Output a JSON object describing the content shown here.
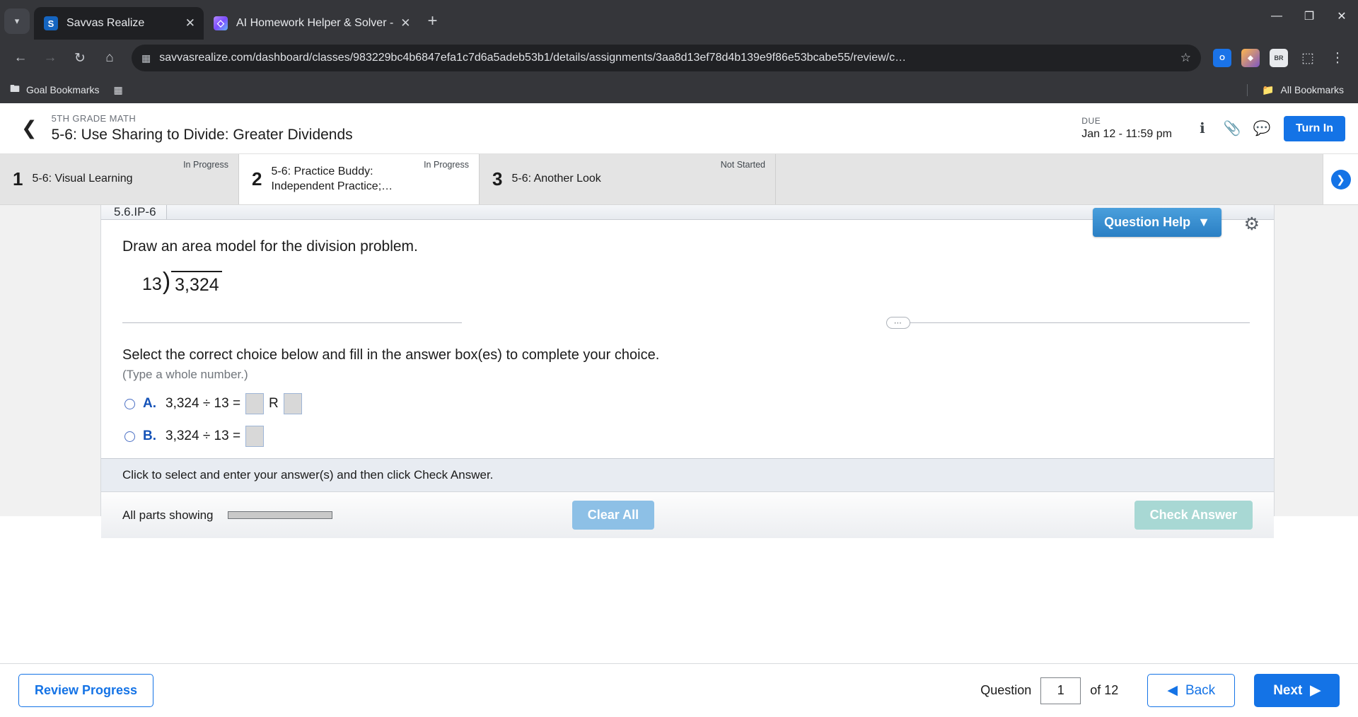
{
  "browser": {
    "tabs": [
      {
        "title": "Savvas Realize",
        "favicon": "savvas-icon",
        "active": true,
        "close_label": "✕"
      },
      {
        "title": "AI Homework Helper & Solver -",
        "favicon": "ai-helper-icon",
        "active": false,
        "close_label": "✕"
      }
    ],
    "new_tab_label": "+",
    "tab_list_icon": "chevron-down-icon",
    "window_controls": {
      "minimize": "—",
      "maximize": "❐",
      "close": "✕"
    },
    "nav": {
      "back": "←",
      "forward": "→",
      "reload": "↻",
      "home": "⌂"
    },
    "omnibox": {
      "site_icon": "page-info-icon",
      "url": "savvasrealize.com/dashboard/classes/983229bc4b6847efa1c7d6a5adeb53b1/details/assignments/3aa8d13ef78d4b139e9f86e53bcabe55/review/c…",
      "star_icon": "☆"
    },
    "extensions": [
      {
        "name": "office-extension",
        "label": "O"
      },
      {
        "name": "grammar-extension",
        "label": "◆"
      },
      {
        "name": "br-extension",
        "label": "BR"
      },
      {
        "name": "extensions-puzzle-icon",
        "label": "⬚"
      }
    ],
    "menu_icon": "⋮",
    "bookmarks": {
      "items": [
        {
          "label": "Goal Bookmarks",
          "icon": "folder-gear-icon"
        },
        {
          "label": "",
          "icon": "apps-grid-icon"
        }
      ],
      "all_bookmarks": {
        "label": "All Bookmarks",
        "icon": "folder-icon"
      }
    }
  },
  "app_header": {
    "back_icon": "back-chevron-icon",
    "eyebrow": "5TH GRADE MATH",
    "title": "5-6: Use Sharing to Divide: Greater Dividends",
    "due_label": "DUE",
    "due_value": "Jan 12 - 11:59 pm",
    "icons": [
      {
        "name": "info-icon",
        "glyph": "ℹ"
      },
      {
        "name": "attachment-icon",
        "glyph": "📎"
      },
      {
        "name": "comment-icon",
        "glyph": "💬"
      }
    ],
    "turn_in_label": "Turn In"
  },
  "assignment_tabs": {
    "items": [
      {
        "num": "1",
        "label": "5-6: Visual Learning",
        "status": "In Progress",
        "active": false
      },
      {
        "num": "2",
        "label": "5-6: Practice Buddy: Independent Practice;…",
        "status": "In Progress",
        "active": true
      },
      {
        "num": "3",
        "label": "5-6: Another Look",
        "status": "Not Started",
        "active": false
      }
    ],
    "next_icon": "chevron-right-icon"
  },
  "question": {
    "code": "5.6.IP-6",
    "help_label": "Question Help",
    "help_caret": "▼",
    "settings_icon": "gear-icon",
    "prompt": "Draw an area model for the division problem.",
    "division": {
      "divisor": "13",
      "bracket": ")",
      "dividend": "3,324"
    },
    "divider_dots": "⋯",
    "instruction": "Select the correct choice below and fill in the answer box(es) to complete your choice.",
    "sub_instruction": "(Type a whole number.)",
    "choices": [
      {
        "letter": "A.",
        "expression": "3,324 ÷ 13 =",
        "remainder_label": "R",
        "boxes": 2
      },
      {
        "letter": "B.",
        "expression": "3,324 ÷ 13 =",
        "remainder_label": "",
        "boxes": 1
      }
    ],
    "footer_note": "Click to select and enter your answer(s) and then click Check Answer.",
    "parts_label": "All parts showing",
    "clear_label": "Clear All",
    "check_label": "Check Answer"
  },
  "bottom_nav": {
    "review_label": "Review Progress",
    "question_label": "Question",
    "question_value": "1",
    "of_label": "of 12",
    "back_label": "Back",
    "back_icon": "◀",
    "next_label": "Next",
    "next_icon": "▶"
  },
  "colors": {
    "accent_blue": "#1473e6",
    "chrome_bg": "#35363a",
    "help_blue": "#2a7fc4",
    "clear_blue": "#8dc0e6",
    "check_teal": "#a8d8d4"
  }
}
